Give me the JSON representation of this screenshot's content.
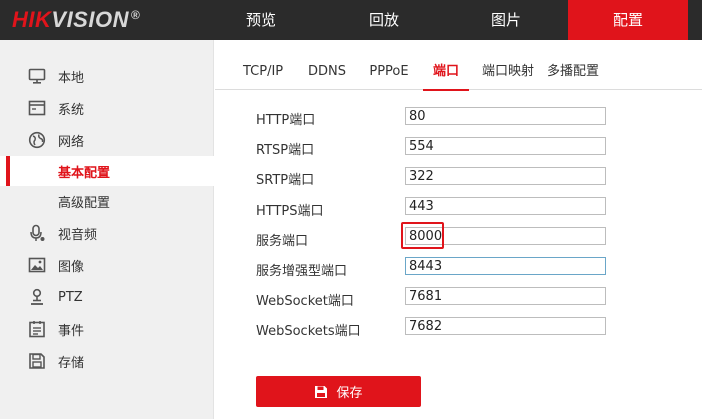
{
  "brand": {
    "hik": "HIK",
    "vision": "VISION",
    "reg": "®"
  },
  "topnav": [
    {
      "label": "预览"
    },
    {
      "label": "回放"
    },
    {
      "label": "图片"
    },
    {
      "label": "配置",
      "active": true
    }
  ],
  "sidebar": {
    "items": [
      {
        "label": "本地",
        "icon": "monitor-icon"
      },
      {
        "label": "系统",
        "icon": "system-window-icon"
      },
      {
        "label": "网络",
        "icon": "globe-icon"
      },
      {
        "label": "基本配置",
        "sub": true,
        "active": true
      },
      {
        "label": "高级配置",
        "sub": true
      },
      {
        "label": "视音频",
        "icon": "microphone-icon"
      },
      {
        "label": "图像",
        "icon": "image-icon"
      },
      {
        "label": "PTZ",
        "icon": "ptz-person-icon"
      },
      {
        "label": "事件",
        "icon": "event-list-icon"
      },
      {
        "label": "存储",
        "icon": "storage-disk-icon"
      }
    ]
  },
  "tabs": [
    {
      "label": "TCP/IP"
    },
    {
      "label": "DDNS"
    },
    {
      "label": "PPPoE"
    },
    {
      "label": "端口",
      "active": true
    },
    {
      "label": "端口映射"
    },
    {
      "label": "多播配置"
    }
  ],
  "ports": [
    {
      "label": "HTTP端口",
      "value": "80"
    },
    {
      "label": "RTSP端口",
      "value": "554"
    },
    {
      "label": "SRTP端口",
      "value": "322"
    },
    {
      "label": "HTTPS端口",
      "value": "443"
    },
    {
      "label": "服务端口",
      "value": "8000",
      "highlighted": true
    },
    {
      "label": "服务增强型端口",
      "value": "8443",
      "focused": true
    },
    {
      "label": "WebSocket端口",
      "value": "7681"
    },
    {
      "label": "WebSockets端口",
      "value": "7682"
    }
  ],
  "save_label": "保存",
  "colors": {
    "accent": "#e0141b",
    "topbar": "#2b2b2b",
    "sidebar": "#f0f0f0"
  }
}
